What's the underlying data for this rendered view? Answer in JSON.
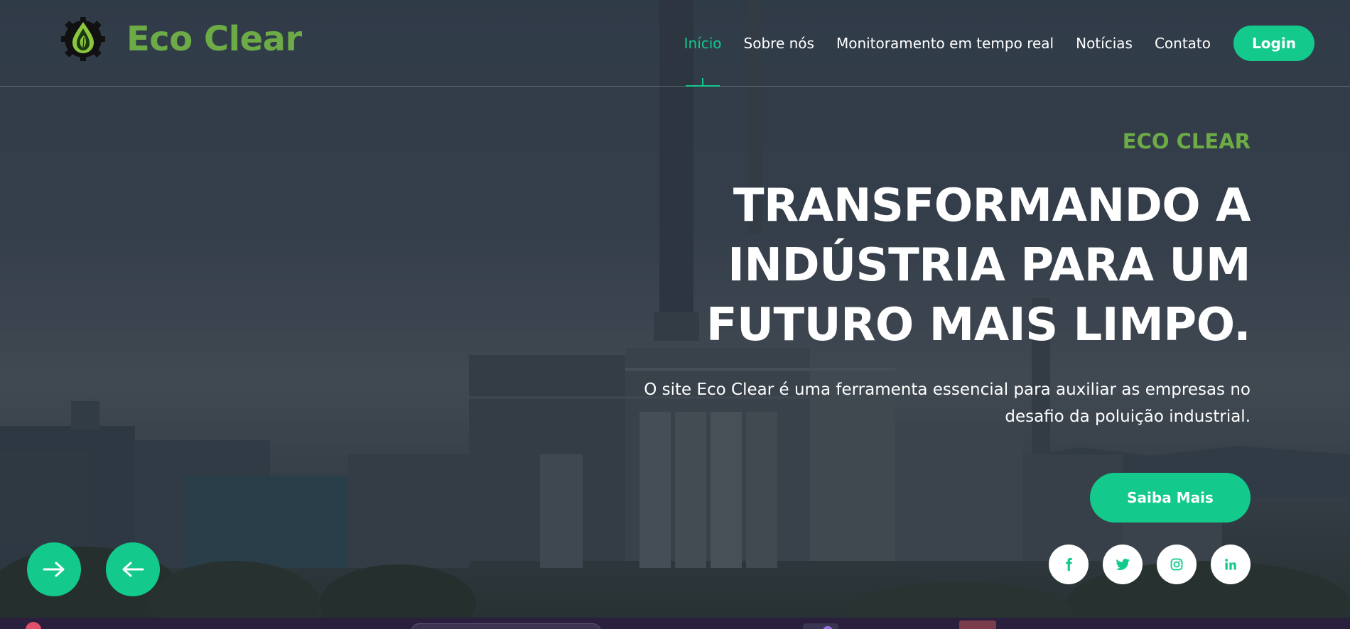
{
  "brand": {
    "name": "Eco Clear",
    "logo_icon": "gear-leaf-drop-icon"
  },
  "nav": {
    "items": [
      {
        "label": "Início",
        "active": true
      },
      {
        "label": "Sobre nós",
        "active": false
      },
      {
        "label": "Monitoramento em tempo real",
        "active": false
      },
      {
        "label": "Notícias",
        "active": false
      },
      {
        "label": "Contato",
        "active": false
      }
    ],
    "login_label": "Login"
  },
  "hero": {
    "eyebrow": "ECO CLEAR",
    "headline": "TRANSFORMANDO A INDÚSTRIA PARA UM FUTURO MAIS LIMPO.",
    "subtitle": "O site Eco Clear é uma ferramenta essencial para auxiliar as empresas no desafio da poluição industrial.",
    "cta_label": "Saiba Mais",
    "background_icon": "industrial-plant-photo"
  },
  "carousel": {
    "next_icon": "arrow-right-icon",
    "prev_icon": "arrow-left-icon"
  },
  "social": [
    {
      "name": "facebook-icon"
    },
    {
      "name": "twitter-icon"
    },
    {
      "name": "instagram-icon"
    },
    {
      "name": "linkedin-icon"
    }
  ],
  "colors": {
    "accent": "#13c98c",
    "brand_green": "#6cab45",
    "text": "#ffffff"
  }
}
